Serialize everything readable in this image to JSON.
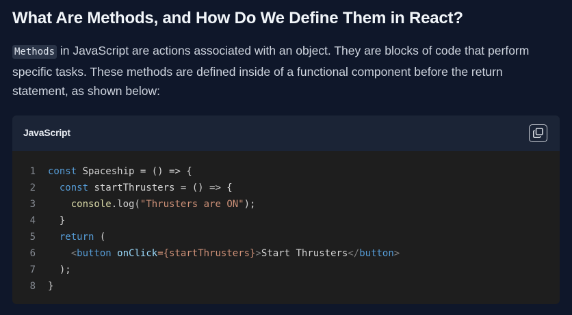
{
  "heading": "What Are Methods, and How Do We Define Them in React?",
  "paragraph": {
    "inline_code": "Methods",
    "text": " in JavaScript are actions associated with an object. They are blocks of code that perform specific tasks. These methods are defined inside of a functional component before the return statement, as shown below:"
  },
  "code_block": {
    "language": "JavaScript",
    "copy_icon": "copy-icon",
    "lines": [
      {
        "number": "1",
        "tokens": [
          [
            "kw",
            "const"
          ],
          [
            "plain",
            " Spaceship = () => {"
          ]
        ]
      },
      {
        "number": "2",
        "tokens": [
          [
            "plain",
            "  "
          ],
          [
            "kw",
            "const"
          ],
          [
            "plain",
            " startThrusters = () => {"
          ]
        ]
      },
      {
        "number": "3",
        "tokens": [
          [
            "plain",
            "    "
          ],
          [
            "fn",
            "console"
          ],
          [
            "plain",
            ".log("
          ],
          [
            "str",
            "\"Thrusters are ON\""
          ],
          [
            "plain",
            ");"
          ]
        ]
      },
      {
        "number": "4",
        "tokens": [
          [
            "plain",
            "  }"
          ]
        ]
      },
      {
        "number": "5",
        "tokens": [
          [
            "plain",
            "  "
          ],
          [
            "kw",
            "return"
          ],
          [
            "plain",
            " ("
          ]
        ]
      },
      {
        "number": "6",
        "tokens": [
          [
            "plain",
            "    "
          ],
          [
            "tagbr",
            "<"
          ],
          [
            "tag",
            "button"
          ],
          [
            "plain",
            " "
          ],
          [
            "attr",
            "onClick"
          ],
          [
            "str",
            "={startThrusters}"
          ],
          [
            "tagbr",
            ">"
          ],
          [
            "plain",
            "Start Thrusters"
          ],
          [
            "tagbr",
            "</"
          ],
          [
            "tag",
            "button"
          ],
          [
            "tagbr",
            ">"
          ]
        ]
      },
      {
        "number": "7",
        "tokens": [
          [
            "plain",
            "  );"
          ]
        ]
      },
      {
        "number": "8",
        "tokens": [
          [
            "plain",
            "}"
          ]
        ]
      }
    ]
  },
  "colors": {
    "page_background": "#0f172a",
    "code_header_background": "#1b2436",
    "code_background": "#1e1e1e",
    "keyword": "#569cd6",
    "string": "#ce9178"
  }
}
